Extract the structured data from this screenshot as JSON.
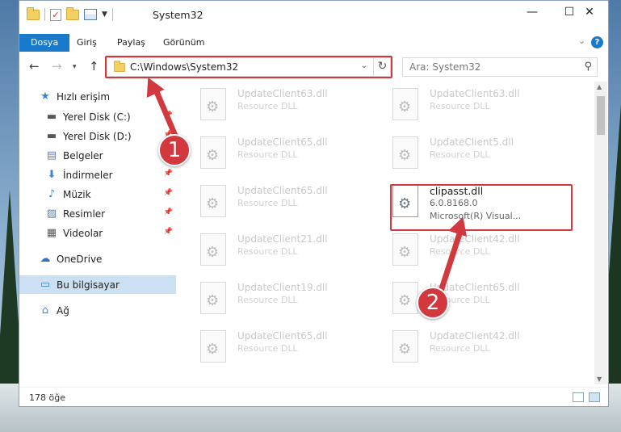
{
  "window": {
    "title": "System32",
    "controls": {
      "minimize": "—",
      "maximize": "☐",
      "close": "✕"
    }
  },
  "ribbon": {
    "tabs": [
      "Dosya",
      "Giriş",
      "Paylaş",
      "Görünüm"
    ],
    "help": "?"
  },
  "nav": {
    "address": "C:\\Windows\\System32",
    "search_placeholder": "Ara: System32"
  },
  "sidebar": {
    "items": [
      {
        "label": "Hızlı erişim",
        "icon": "star-icon",
        "pinned": false
      },
      {
        "label": "Yerel Disk (C:)",
        "icon": "drive-icon",
        "pinned": true
      },
      {
        "label": "Yerel Disk (D:)",
        "icon": "drive-icon",
        "pinned": true
      },
      {
        "label": "Belgeler",
        "icon": "document-icon",
        "pinned": true
      },
      {
        "label": "İndirmeler",
        "icon": "download-icon",
        "pinned": true
      },
      {
        "label": "Müzik",
        "icon": "music-icon",
        "pinned": true
      },
      {
        "label": "Resimler",
        "icon": "pictures-icon",
        "pinned": true
      },
      {
        "label": "Videolar",
        "icon": "video-icon",
        "pinned": true
      },
      {
        "label": "OneDrive",
        "icon": "cloud-icon",
        "pinned": false
      },
      {
        "label": "Bu bilgisayar",
        "icon": "computer-icon",
        "pinned": false,
        "selected": true
      },
      {
        "label": "Ağ",
        "icon": "network-icon",
        "pinned": false
      }
    ]
  },
  "files": [
    {
      "name": "UpdateClient63.dll",
      "desc": "Resource DLL"
    },
    {
      "name": "UpdateClient63.dll",
      "desc": "Resource DLL"
    },
    {
      "name": "UpdateClient65.dll",
      "desc": "Resource DLL"
    },
    {
      "name": "UpdateClient5.dll",
      "desc": "Resource DLL"
    },
    {
      "name": "UpdateClient65.dll",
      "desc": "Resource DLL"
    },
    {
      "name": "clipasst.dll",
      "desc": "6.0.8168.0",
      "desc2": "Microsoft(R) Visual...",
      "focus": true
    },
    {
      "name": "UpdateClient21.dll",
      "desc": "Resource DLL"
    },
    {
      "name": "UpdateClient42.dll",
      "desc": "Resource DLL"
    },
    {
      "name": "UpdateClient19.dll",
      "desc": "Resource DLL"
    },
    {
      "name": "UpdateClient65.dll",
      "desc": "Resource DLL"
    },
    {
      "name": "UpdateClient65.dll",
      "desc": "Resource DLL"
    },
    {
      "name": "UpdateClient42.dll",
      "desc": "Resource DLL"
    }
  ],
  "status": {
    "count": "178 öğe"
  },
  "annotations": {
    "step1": "1",
    "step2": "2"
  },
  "colors": {
    "accent": "#1979ca",
    "highlight": "#d2393e",
    "selection": "#cce0f3"
  }
}
